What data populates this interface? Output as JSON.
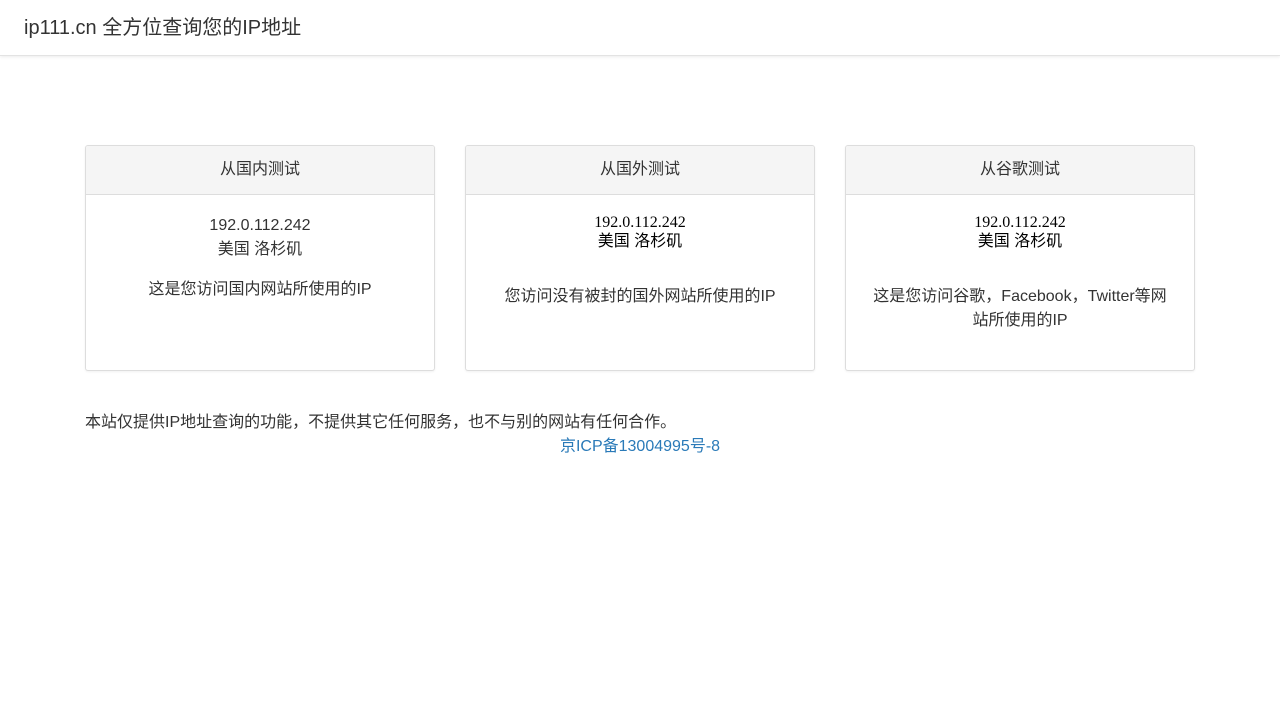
{
  "header": {
    "brand": "ip111.cn 全方位查询您的IP地址"
  },
  "panels": [
    {
      "title": "从国内测试",
      "ip": "192.0.112.242",
      "location": "美国 洛杉矶",
      "description": "这是您访问国内网站所使用的IP"
    },
    {
      "title": "从国外测试",
      "ip": "192.0.112.242",
      "location": "美国 洛杉矶",
      "description": "您访问没有被封的国外网站所使用的IP"
    },
    {
      "title": "从谷歌测试",
      "ip": "192.0.112.242",
      "location": "美国 洛杉矶",
      "description": "这是您访问谷歌，Facebook，Twitter等网站所使用的IP"
    }
  ],
  "footer": {
    "note": "本站仅提供IP地址查询的功能，不提供其它任何服务，也不与别的网站有任何合作。",
    "icp_link": "京ICP备13004995号-8"
  },
  "colors": {
    "link": "#2a7ab8",
    "panel_heading_bg": "#f5f5f5",
    "border": "#dddddd"
  }
}
